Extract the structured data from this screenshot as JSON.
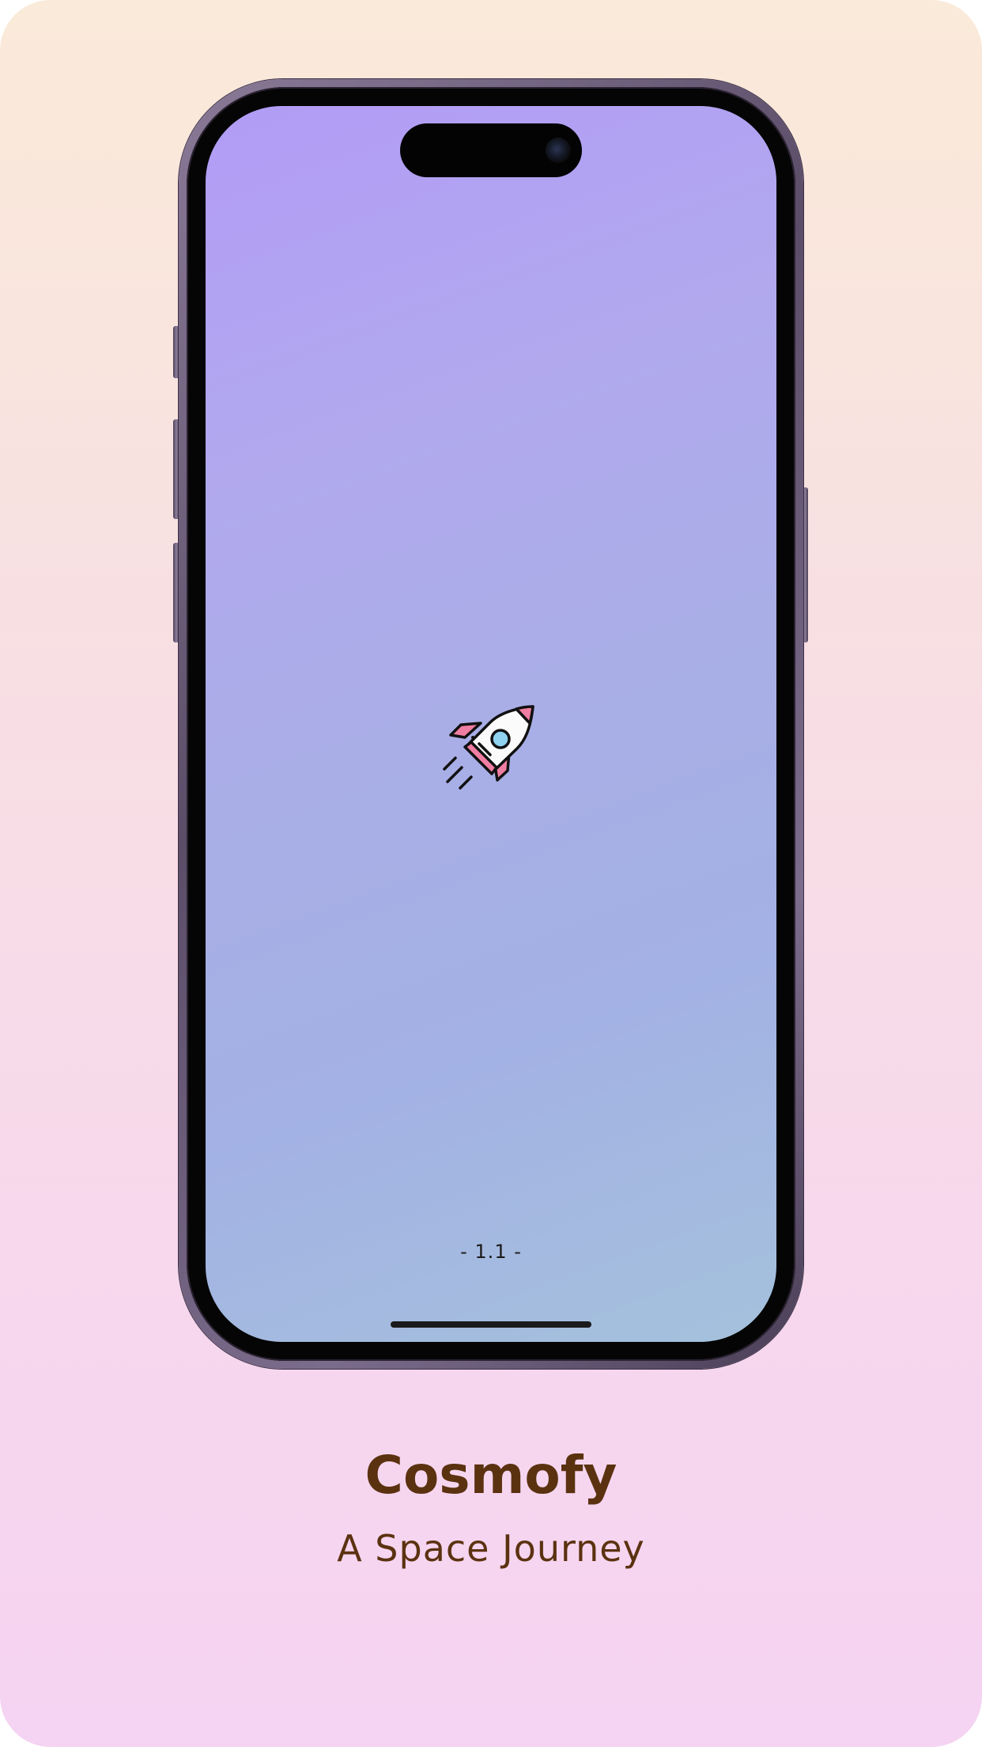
{
  "screen": {
    "version_label": "- 1.1 -",
    "icon": "rocket-icon"
  },
  "caption": {
    "app_name": "Cosmofy",
    "tagline": "A Space Journey"
  },
  "colors": {
    "caption_text": "#5b3210",
    "screen_top": "#b29cf6",
    "screen_bottom": "#a4c1dc",
    "rocket_accent": "#f07ea2",
    "rocket_window": "#8fd3f0"
  }
}
